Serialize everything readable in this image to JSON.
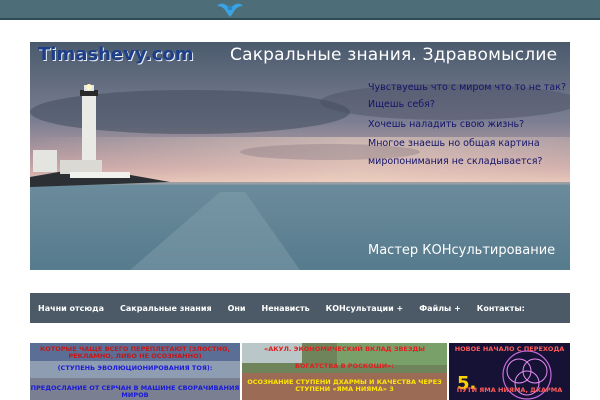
{
  "header": {
    "bird_icon": "bird-icon"
  },
  "banner": {
    "logo": "Timashevy.com",
    "title": "Сакральные знания. Здравомыслие",
    "lines": [
      "Чувствуешь что с миром что то не так?",
      "Ищешь себя?",
      "Хочешь наладить свою жизнь?",
      "Многое знаешь но общая картина",
      "миропонимания не складывается?"
    ],
    "footer": "Мастер КОНсультирование"
  },
  "nav": {
    "items": [
      "Начни отсюда",
      "Сакральные знания",
      "Они",
      "Ненависть",
      "КОНсультации +",
      "Файлы +",
      "Контакты:"
    ]
  },
  "thumbnails": [
    {
      "caption_top": "КОТОРЫЕ ЧАЩЕ ВСЕГО ПЕРЕПЛЕТАЮТ (ЗЛОСТНО, РЕКЛАМНО, ЛИБО НЕ ОСОЗНАННО)",
      "caption_mid": "(СТУПЕНЬ ЭВОЛЮЦИОНИРОВАНИЯ ТОЯ):",
      "caption_bottom": "ПРЕДОСЛАНИЕ ОТ СЕРЧАН В МАШИНЕ СВОРАЧИВАНИЯ МИРОВ"
    },
    {
      "caption_top": "«АКУЛ. ЭКОНОМИЧЕСКИЙ ВКЛАД ЗВЕЗДЫ",
      "caption_mid": "БОГАТСТВА В РОСКОШИ»:",
      "caption_bottom": "ОСОЗНАНИЕ СТУПЕНИ ДХАРМЫ И КАЧЕСТВА ЧЕРЕЗ СТУПЕНИ «ЯМА НИЯМА» 3"
    },
    {
      "caption_top": "НОВОЕ НАЧАЛО С ПЕРЕХОДА",
      "number": "5.",
      "caption_bottom": "ПУТИ ЯМА НИЯМА, ДХАРМА"
    }
  ]
}
